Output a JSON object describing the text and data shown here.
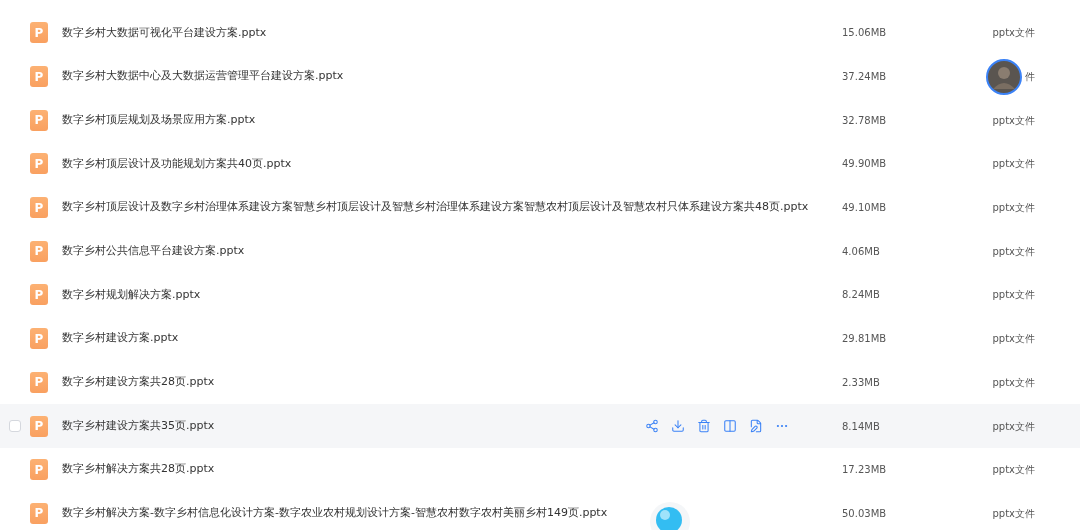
{
  "files": [
    {
      "icon_letter": "P",
      "name": "数字乡村大数据可视化平台建设方案.pptx",
      "size": "15.06MB",
      "type": "pptx文件",
      "hovered": false
    },
    {
      "icon_letter": "P",
      "name": "数字乡村大数据中心及大数据运营管理平台建设方案.pptx",
      "size": "37.24MB",
      "type": "件",
      "hovered": false,
      "avatar": true
    },
    {
      "icon_letter": "P",
      "name": "数字乡村顶层规划及场景应用方案.pptx",
      "size": "32.78MB",
      "type": "pptx文件",
      "hovered": false
    },
    {
      "icon_letter": "P",
      "name": "数字乡村顶层设计及功能规划方案共40页.pptx",
      "size": "49.90MB",
      "type": "pptx文件",
      "hovered": false
    },
    {
      "icon_letter": "P",
      "name": "数字乡村顶层设计及数字乡村治理体系建设方案智慧乡村顶层设计及智慧乡村治理体系建设方案智慧农村顶层设计及智慧农村只体系建设方案共48页.pptx",
      "size": "49.10MB",
      "type": "pptx文件",
      "hovered": false
    },
    {
      "icon_letter": "P",
      "name": "数字乡村公共信息平台建设方案.pptx",
      "size": "4.06MB",
      "type": "pptx文件",
      "hovered": false
    },
    {
      "icon_letter": "P",
      "name": "数字乡村规划解决方案.pptx",
      "size": "8.24MB",
      "type": "pptx文件",
      "hovered": false
    },
    {
      "icon_letter": "P",
      "name": "数字乡村建设方案.pptx",
      "size": "29.81MB",
      "type": "pptx文件",
      "hovered": false
    },
    {
      "icon_letter": "P",
      "name": "数字乡村建设方案共28页.pptx",
      "size": "2.33MB",
      "type": "pptx文件",
      "hovered": false
    },
    {
      "icon_letter": "P",
      "name": "数字乡村建设方案共35页.pptx",
      "size": "8.14MB",
      "type": "pptx文件",
      "hovered": true
    },
    {
      "icon_letter": "P",
      "name": "数字乡村解决方案共28页.pptx",
      "size": "17.23MB",
      "type": "pptx文件",
      "hovered": false
    },
    {
      "icon_letter": "P",
      "name": "数字乡村解决方案-数字乡村信息化设计方案-数字农业农村规划设计方案-智慧农村数字农村美丽乡村149页.pptx",
      "size": "50.03MB",
      "type": "pptx文件",
      "hovered": false
    }
  ]
}
